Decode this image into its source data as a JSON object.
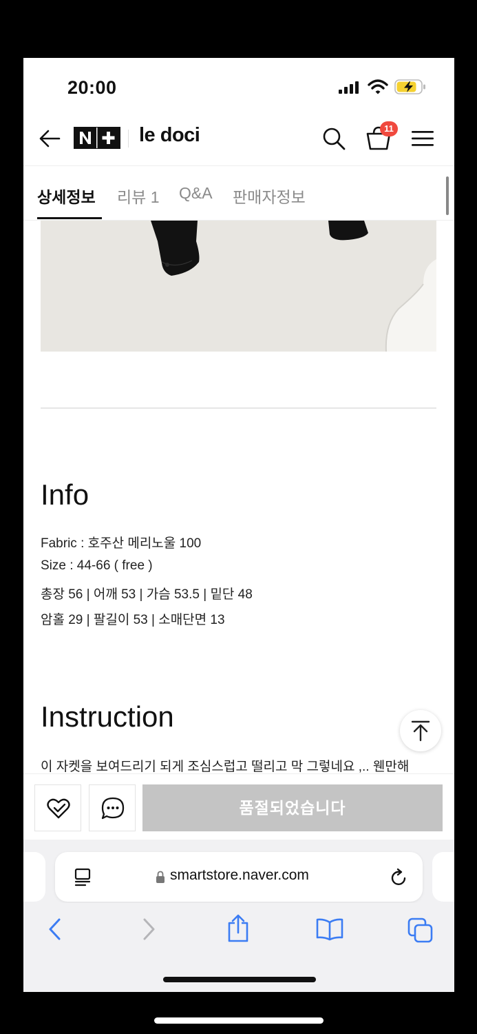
{
  "status_bar": {
    "time": "20:00"
  },
  "header": {
    "brand_badge": "N+",
    "store_name": "le doci",
    "cart_count": "11"
  },
  "tabs": [
    {
      "label": "상세정보",
      "active": true
    },
    {
      "label": "리뷰 1",
      "active": false
    },
    {
      "label": "Q&A",
      "active": false
    },
    {
      "label": "판매자정보",
      "active": false
    }
  ],
  "content": {
    "info_heading": "Info",
    "info_lines": [
      "Fabric : 호주산 메리노울 100",
      "Size : 44-66 ( free )",
      "총장 56  |  어깨 53  |  가슴 53.5  |  밑단 48",
      "암홀 29  |  팔길이 53  | 소매단면 13"
    ],
    "instruction_heading": "Instruction",
    "instruction_text": "이 자켓을 보여드리기 되게 조심스럽고 떨리고 막 그렇네요 ,.. 웬만해"
  },
  "action_bar": {
    "soldout_label": "품절되었습니다"
  },
  "browser": {
    "url": "smartstore.naver.com"
  },
  "colors": {
    "badge": "#f0493e",
    "safari_blue": "#3b7cf3",
    "soldout_bg": "#c4c4c4"
  }
}
